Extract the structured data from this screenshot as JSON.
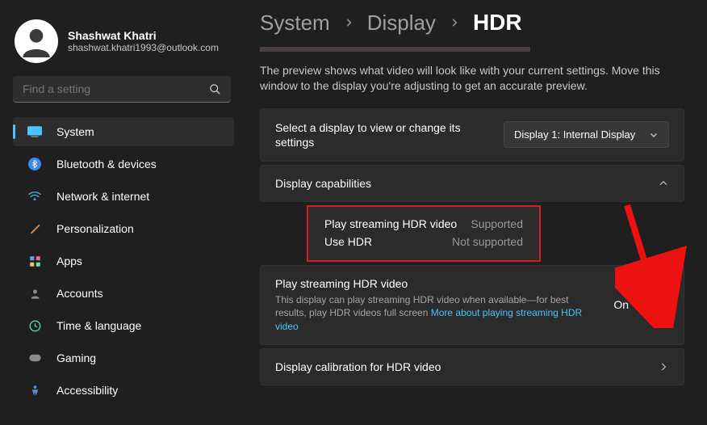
{
  "profile": {
    "name": "Shashwat Khatri",
    "email": "shashwat.khatri1993@outlook.com"
  },
  "search": {
    "placeholder": "Find a setting"
  },
  "nav": {
    "items": [
      {
        "label": "System"
      },
      {
        "label": "Bluetooth & devices"
      },
      {
        "label": "Network & internet"
      },
      {
        "label": "Personalization"
      },
      {
        "label": "Apps"
      },
      {
        "label": "Accounts"
      },
      {
        "label": "Time & language"
      },
      {
        "label": "Gaming"
      },
      {
        "label": "Accessibility"
      }
    ],
    "active_index": 0
  },
  "breadcrumb": {
    "seg1": "System",
    "seg2": "Display",
    "seg3": "HDR"
  },
  "preview_note": "The preview shows what video will look like with your current settings. Move this window to the display you're adjusting to get an accurate preview.",
  "select_display": {
    "label": "Select a display to view or change its settings",
    "selected": "Display 1: Internal Display"
  },
  "capabilities": {
    "title": "Display capabilities",
    "rows": [
      {
        "k": "Play streaming HDR video",
        "v": "Supported"
      },
      {
        "k": "Use HDR",
        "v": "Not supported"
      }
    ]
  },
  "stream_hdr": {
    "title": "Play streaming HDR video",
    "desc": "This display can play streaming HDR video when available—for best results, play HDR videos full screen   ",
    "link": "More about playing streaming HDR video",
    "state_label": "On",
    "state": true
  },
  "calibration": {
    "title": "Display calibration for HDR video"
  }
}
